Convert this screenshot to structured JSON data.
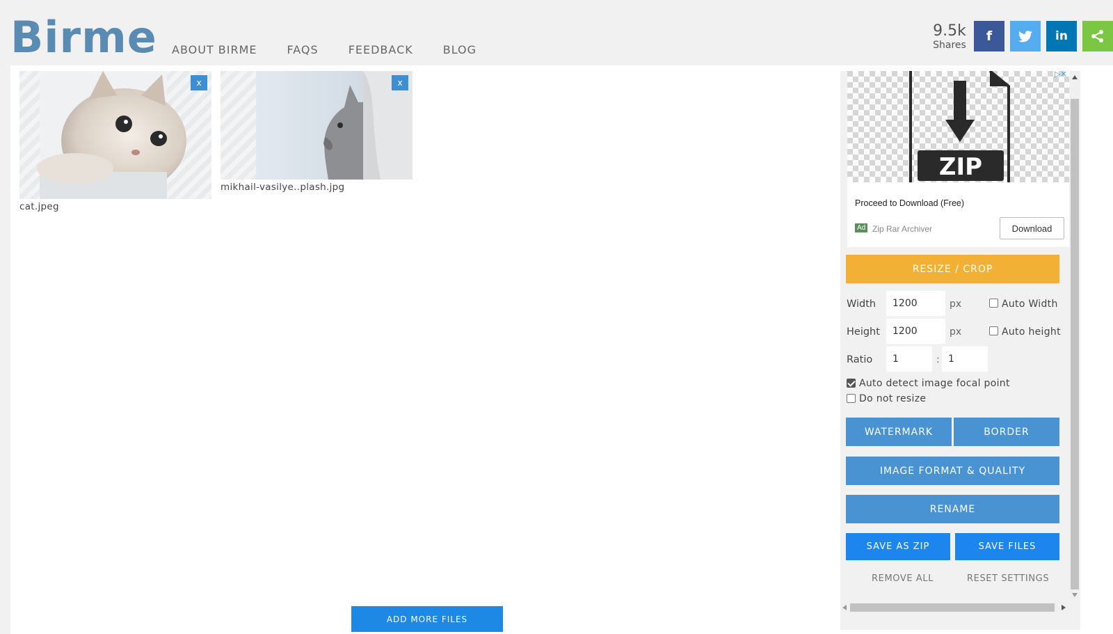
{
  "header": {
    "logo": "Birme",
    "nav": [
      "ABOUT BIRME",
      "FAQS",
      "FEEDBACK",
      "BLOG"
    ],
    "shares_count": "9.5k",
    "shares_label": "Shares",
    "social": {
      "facebook": "f",
      "twitter": "twitter-bird",
      "linkedin": "in",
      "share": "share-icon"
    }
  },
  "files": [
    {
      "name": "cat.jpeg",
      "close": "x"
    },
    {
      "name": "mikhail-vasilye..plash.jpg",
      "close": "x"
    }
  ],
  "add_more_label": "ADD MORE FILES",
  "ad": {
    "title": "Proceed to Download (Free)",
    "badge": "Ad",
    "advertiser": "Zip Rar Archiver",
    "button": "Download",
    "image_text": "ZIP"
  },
  "panel": {
    "resize_crop": "RESIZE / CROP",
    "width_label": "Width",
    "width_value": "1200",
    "height_label": "Height",
    "height_value": "1200",
    "unit": "px",
    "auto_width": "Auto Width",
    "auto_height": "Auto height",
    "ratio_label": "Ratio",
    "ratio_a": "1",
    "ratio_sep": ":",
    "ratio_b": "1",
    "focal_point": "Auto detect image focal point",
    "focal_point_checked": true,
    "no_resize": "Do not resize",
    "no_resize_checked": false,
    "watermark": "WATERMARK",
    "border": "BORDER",
    "format_quality": "IMAGE FORMAT & QUALITY",
    "rename": "RENAME",
    "save_zip": "SAVE AS ZIP",
    "save_files": "SAVE FILES",
    "remove_all": "REMOVE ALL",
    "reset_settings": "RESET SETTINGS"
  },
  "colors": {
    "accent_orange": "#f2b135",
    "button_blue": "#4a93d3",
    "bright_blue": "#1c86ee",
    "facebook": "#3b5998",
    "twitter": "#55acee",
    "linkedin": "#0077b5",
    "share": "#7bc744",
    "logo": "#5a8cb3"
  }
}
